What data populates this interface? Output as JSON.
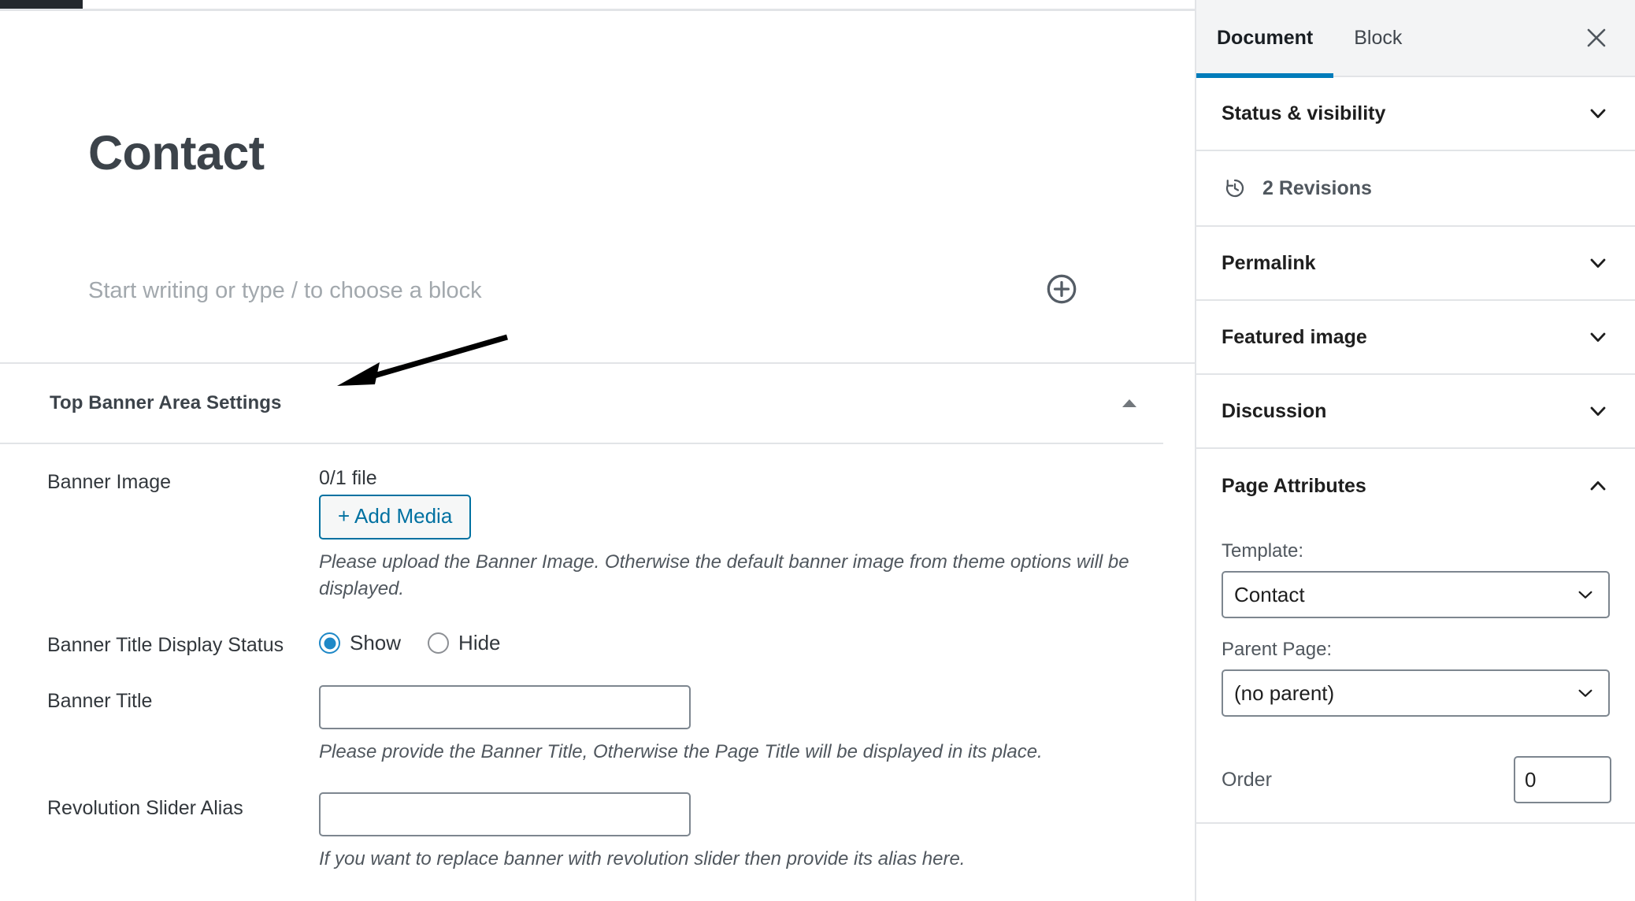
{
  "editor": {
    "post_title": "Contact",
    "block_placeholder": "Start writing or type / to choose a block",
    "inserter_icon": "plus-circle-icon"
  },
  "metabox": {
    "title": "Top Banner Area Settings",
    "toggle_icon": "caret-up-icon",
    "annotation": "arrow-pointing-left",
    "fields": {
      "banner_image": {
        "label": "Banner Image",
        "file_count": "0/1 file",
        "add_media_label": "+ Add Media",
        "help": "Please upload the Banner Image. Otherwise the default banner image from theme options will be displayed."
      },
      "banner_title_status": {
        "label": "Banner Title Display Status",
        "options": [
          {
            "label": "Show",
            "checked": true
          },
          {
            "label": "Hide",
            "checked": false
          }
        ]
      },
      "banner_title": {
        "label": "Banner Title",
        "value": "",
        "help": "Please provide the Banner Title, Otherwise the Page Title will be displayed in its place."
      },
      "revolution_slider_alias": {
        "label": "Revolution Slider Alias",
        "value": "",
        "help": "If you want to replace banner with revolution slider then provide its alias here."
      }
    }
  },
  "sidebar": {
    "tabs": [
      {
        "label": "Document",
        "active": true
      },
      {
        "label": "Block",
        "active": false
      }
    ],
    "close_icon": "close-icon",
    "panels": [
      {
        "label": "Status & visibility",
        "expanded": false,
        "icon": "chevron-down-icon"
      },
      {
        "label": "Permalink",
        "expanded": false,
        "icon": "chevron-down-icon"
      },
      {
        "label": "Featured image",
        "expanded": false,
        "icon": "chevron-down-icon"
      },
      {
        "label": "Discussion",
        "expanded": false,
        "icon": "chevron-down-icon"
      },
      {
        "label": "Page Attributes",
        "expanded": true,
        "icon": "chevron-up-icon"
      }
    ],
    "revisions": {
      "label": "2 Revisions",
      "icon": "revisions-clock-icon"
    },
    "page_attributes": {
      "template_label": "Template:",
      "template_value": "Contact",
      "parent_label": "Parent Page:",
      "parent_value": "(no parent)",
      "order_label": "Order",
      "order_value": "0"
    }
  },
  "colors": {
    "accent_blue": "#007cba",
    "link_blue": "#0071a1",
    "radio_blue": "#1e88c7",
    "border_gray": "#e2e4e7",
    "text_dark": "#1e1e1e",
    "text_muted": "#50575e",
    "admin_bar": "#23282d"
  }
}
